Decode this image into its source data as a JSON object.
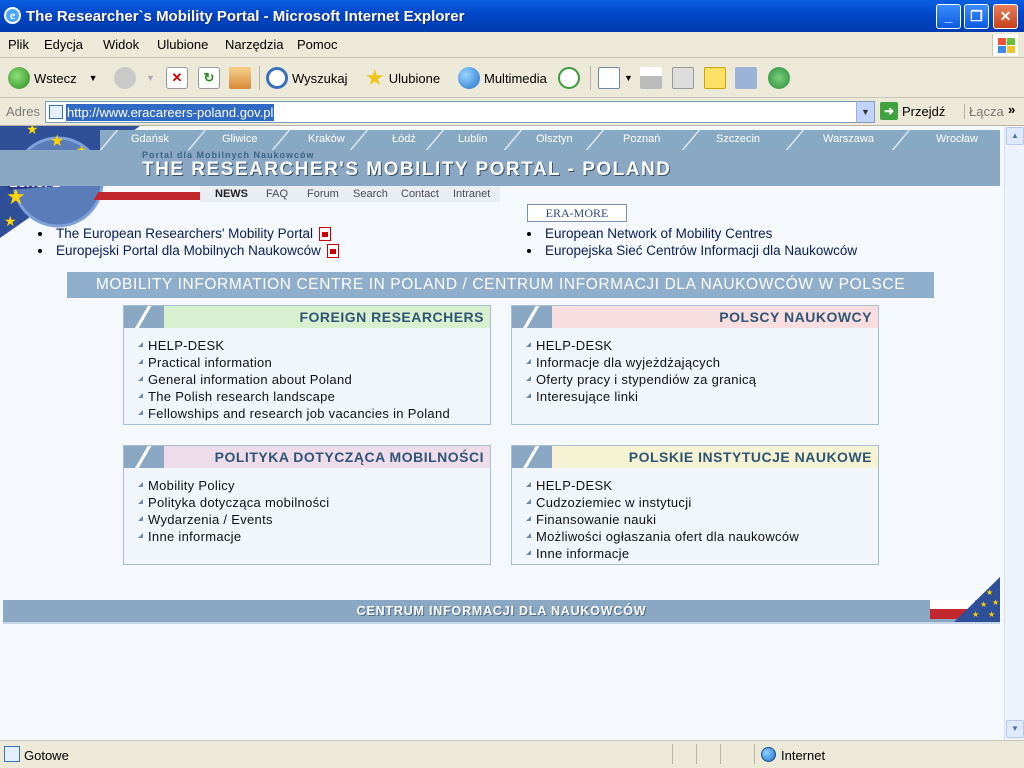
{
  "window": {
    "title": "The Researcher`s Mobility Portal - Microsoft Internet Explorer"
  },
  "menu": [
    "Plik",
    "Edycja",
    "Widok",
    "Ulubione",
    "Narzędzia",
    "Pomoc"
  ],
  "toolbar": {
    "back": "Wstecz",
    "search": "Wyszukaj",
    "favorites": "Ulubione",
    "media": "Multimedia"
  },
  "address": {
    "label": "Adres",
    "url": "http://www.eracareers-poland.gov.pl",
    "go": "Przejdź",
    "links": "Łącza"
  },
  "page": {
    "cities": [
      "Gdańsk",
      "Gliwice",
      "Kraków",
      "Łódź",
      "Lublin",
      "Olsztyn",
      "Poznań",
      "Szczecin",
      "Warszawa",
      "Wrocław"
    ],
    "logo_text": "EUROPE",
    "banner_sub": "Portal dla Mobilnych Naukowców",
    "banner_title": "THE RESEARCHER'S MOBILITY PORTAL - POLAND",
    "subnav": [
      "NEWS",
      "FAQ",
      "Forum",
      "Search",
      "Contact",
      "Intranet"
    ],
    "links_left": [
      "The European Researchers' Mobility Portal",
      "Europejski Portal dla Mobilnych Naukowców"
    ],
    "eramore_label": "ERA-MORE",
    "links_right": [
      "European Network of Mobility Centres",
      "Europejska Sieć Centrów Informacji dla Naukowców"
    ],
    "mic_header": "MOBILITY INFORMATION CENTRE IN POLAND / CENTRUM INFORMACJI DLA NAUKOWCÓW W POLSCE",
    "cards": [
      {
        "title": "FOREIGN RESEARCHERS",
        "items": [
          "HELP-DESK",
          "Practical information",
          "General information about Poland",
          "The Polish research landscape",
          "Fellowships and research job vacancies in Poland"
        ]
      },
      {
        "title": "POLSCY NAUKOWCY",
        "items": [
          "HELP-DESK",
          "Informacje dla wyjeżdżających",
          "Oferty pracy i stypendiów za granicą",
          "Interesujące linki"
        ]
      },
      {
        "title": "POLITYKA DOTYCZĄCA MOBILNOŚCI",
        "items": [
          "Mobility Policy",
          "Polityka dotycząca mobilności",
          "Wydarzenia / Events",
          "Inne informacje"
        ]
      },
      {
        "title": "POLSKIE INSTYTUCJE NAUKOWE",
        "items": [
          "HELP-DESK",
          "Cudzoziemiec w instytucji",
          "Finansowanie nauki",
          "Możliwości ogłaszania ofert dla naukowców",
          "Inne informacje"
        ]
      }
    ],
    "footer": "CENTRUM INFORMACJI DLA NAUKOWCÓW"
  },
  "status": {
    "text": "Gotowe",
    "zone": "Internet"
  },
  "colors": {
    "title_bar": "#0047c8",
    "banner": "#8aa8c3",
    "card_foreign": "#d8f0d0",
    "card_polscy": "#f8dede",
    "card_polityka": "#eedceb",
    "card_instytucje": "#f6f2d4"
  }
}
